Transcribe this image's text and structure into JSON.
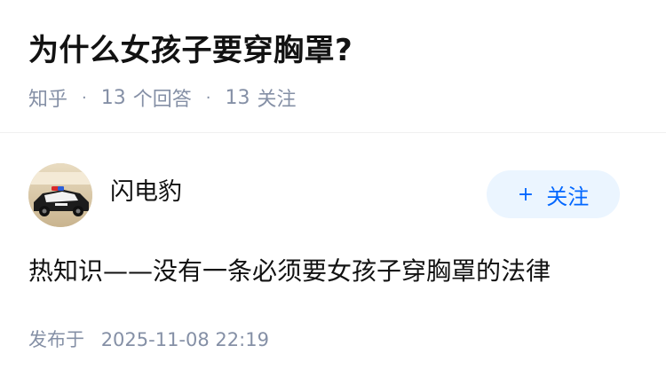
{
  "question": {
    "title": "为什么女孩子要穿胸罩?",
    "source": "知乎",
    "answer_count": "13",
    "answer_label": "个回答",
    "follow_count": "13",
    "follow_label": "关注"
  },
  "answer": {
    "author_name": "闪电豹",
    "follow_button_icon": "plus",
    "follow_button_label": "关注",
    "text": "热知识——没有一条必须要女孩子穿胸罩的法律",
    "publish_label": "发布于",
    "publish_time": "2025-11-08 22:19"
  },
  "colors": {
    "accent": "#0066ff",
    "accent_bg": "#ebf5ff",
    "meta_text": "#8590a6",
    "title_text": "#121212"
  }
}
